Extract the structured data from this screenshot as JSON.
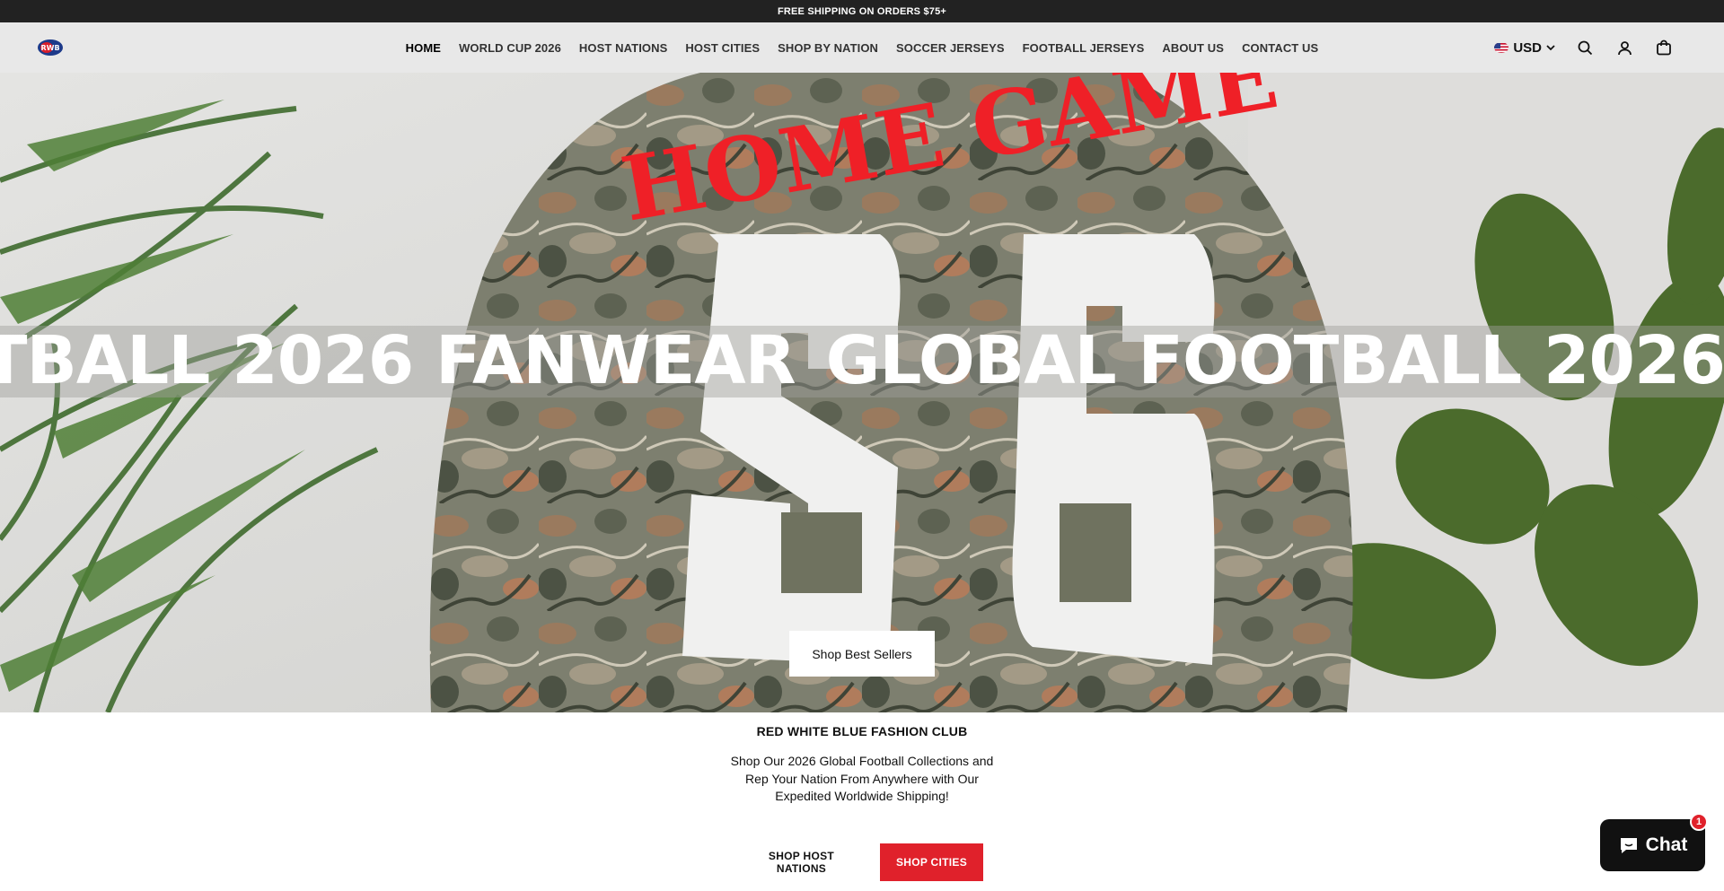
{
  "announcement": {
    "text": "FREE SHIPPING ON ORDERS $75+"
  },
  "header": {
    "logo_alt": "RWB",
    "nav": [
      {
        "label": "HOME",
        "active": true
      },
      {
        "label": "WORLD CUP 2026"
      },
      {
        "label": "HOST NATIONS"
      },
      {
        "label": "HOST CITIES"
      },
      {
        "label": "SHOP BY NATION"
      },
      {
        "label": "SOCCER JERSEYS"
      },
      {
        "label": "FOOTBALL JERSEYS"
      },
      {
        "label": "ABOUT US"
      },
      {
        "label": "CONTACT US"
      }
    ],
    "currency": {
      "label": "USD",
      "icon": "us-flag-icon"
    },
    "icons": [
      "search-icon",
      "account-icon",
      "cart-icon"
    ]
  },
  "hero": {
    "marquee_text": "GLOBAL FOOTBALL 2026 FANWEAR",
    "marquee_prefix": "TBALL 2026 FANWEAR",
    "button_label": "Shop Best Sellers",
    "image_text": {
      "arch": "HOME GAME",
      "number": "26"
    }
  },
  "intro": {
    "heading": "RED WHITE BLUE FASHION CLUB",
    "body": "Shop Our 2026 Global Football Collections and Rep Your Nation From Anywhere with Our Expedited Worldwide Shipping!",
    "buttons": {
      "host_nations": "SHOP HOST NATIONS",
      "cities": "SHOP CITIES"
    }
  },
  "chat": {
    "label": "Chat",
    "badge_count": "1"
  },
  "colors": {
    "accent_red": "#e0212b",
    "announcement_bg": "#222222",
    "header_bg": "#e8e8e8"
  }
}
